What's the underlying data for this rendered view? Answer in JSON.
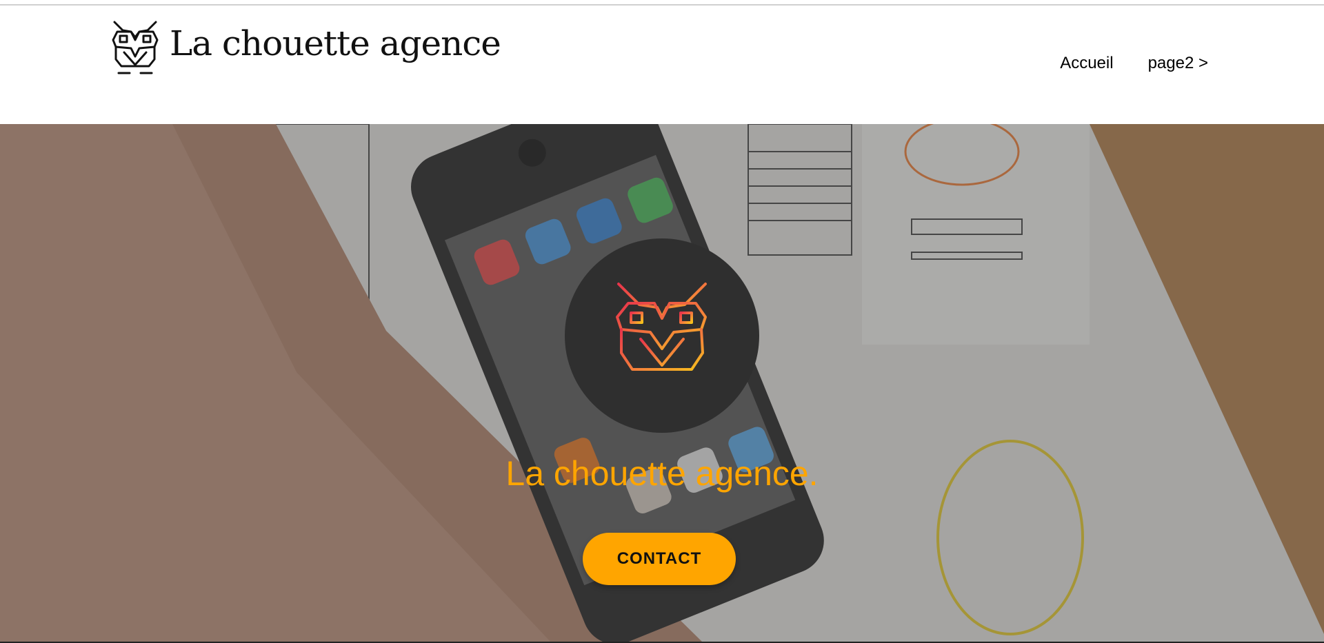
{
  "header": {
    "logo_text": "La chouette agence",
    "logo_icon": "owl-icon"
  },
  "nav": {
    "items": [
      {
        "label": "Accueil"
      },
      {
        "label": "page2 >"
      }
    ]
  },
  "hero": {
    "badge_icon": "owl-gradient-icon",
    "title": "La chouette agence.",
    "cta_label": "CONTACT",
    "background": "workspace-photo"
  },
  "colors": {
    "accent": "#ffa500",
    "badge_bg": "#2f2f2f",
    "owl_gradient_start": "#e8344b",
    "owl_gradient_end": "#f6c21c"
  }
}
